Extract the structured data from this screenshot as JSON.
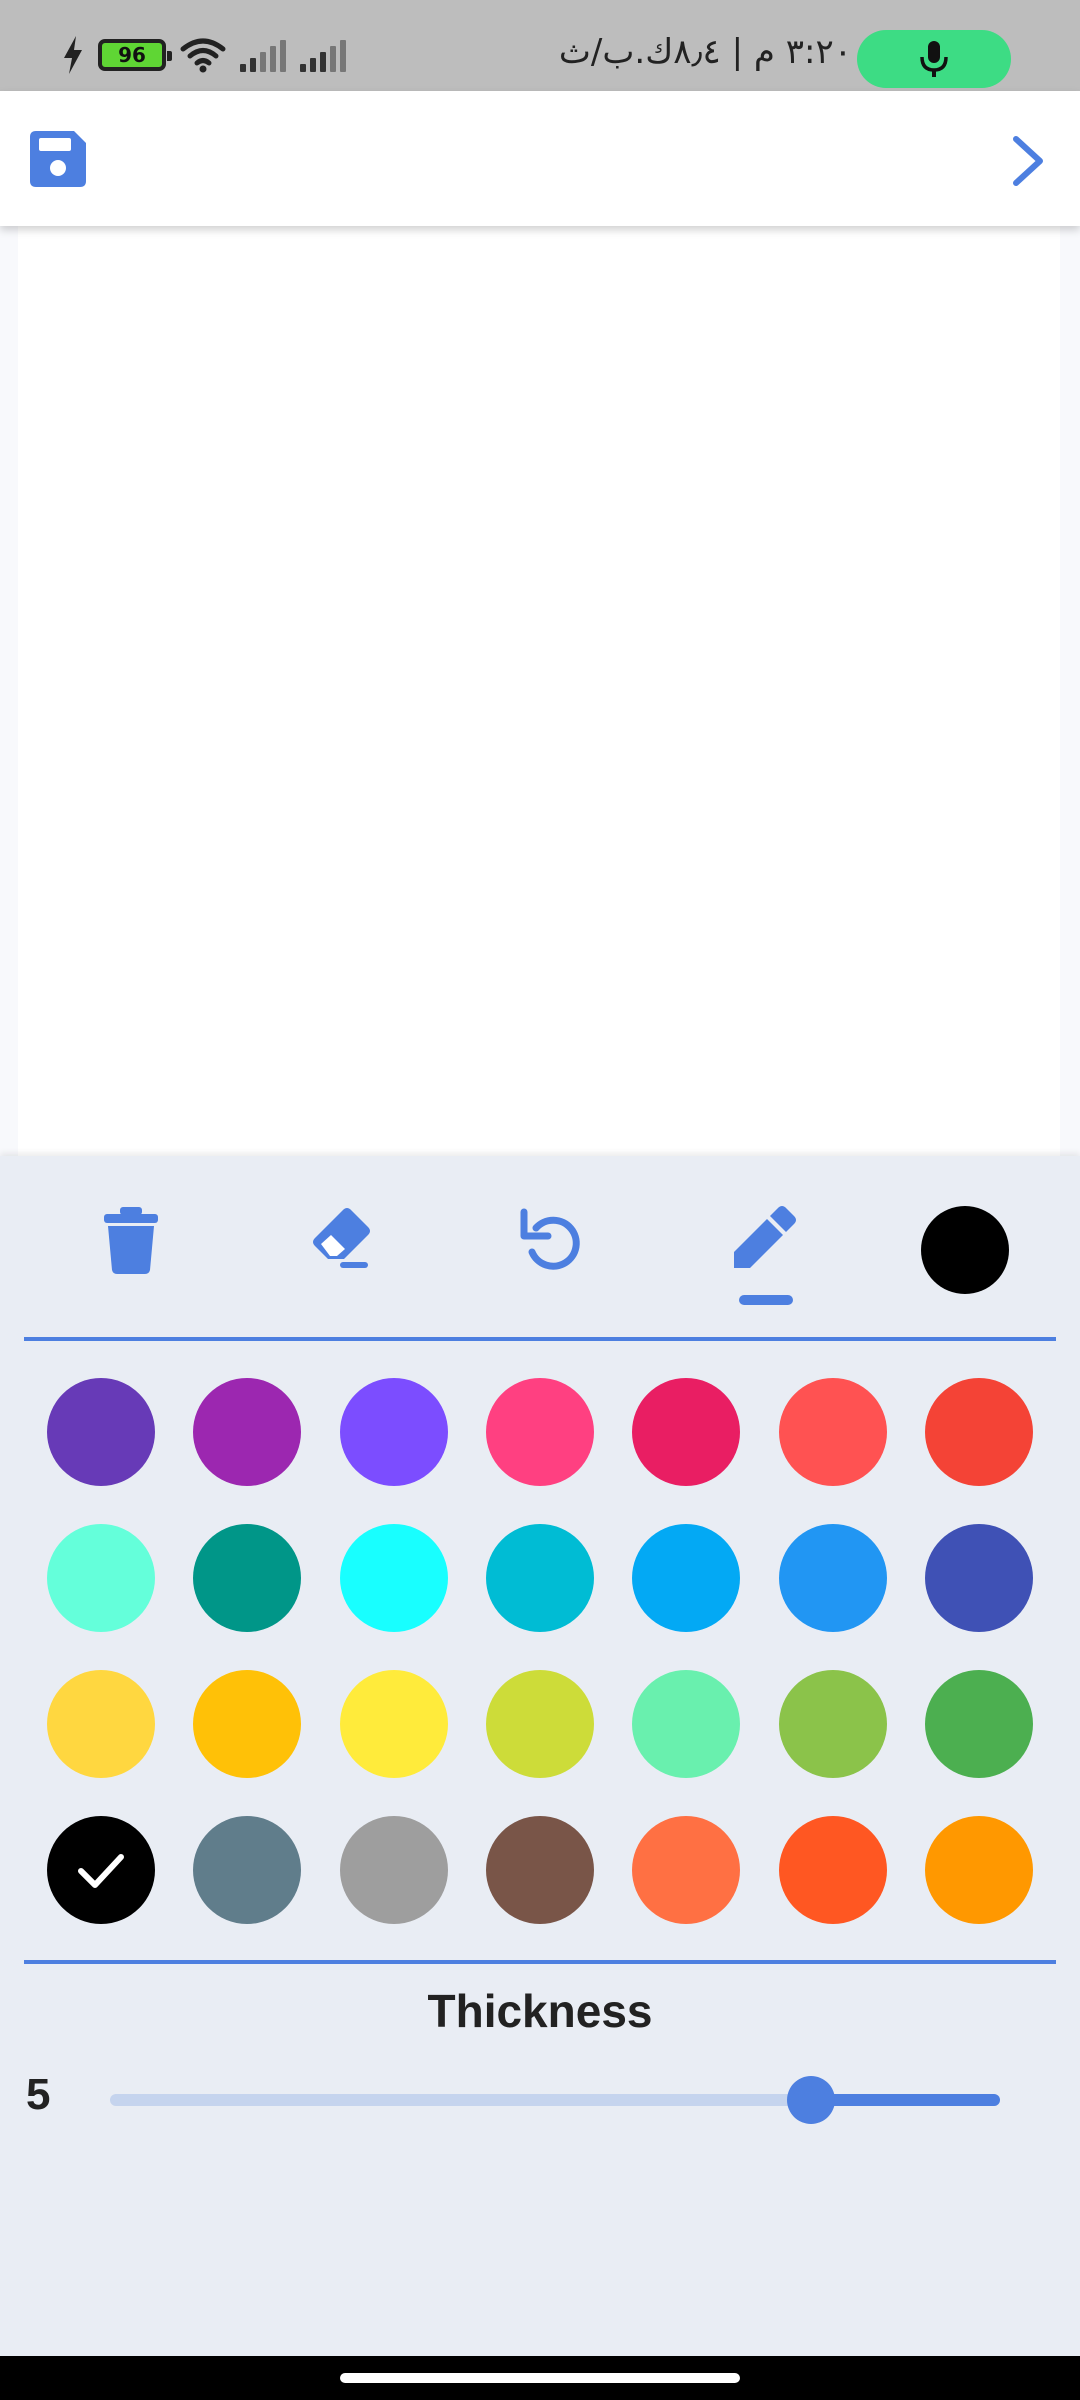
{
  "status_bar": {
    "battery_level": "96",
    "time_and_speed": "٣:٢٠ م | ٨٫٤ك.ب/ث",
    "mic_pill_color": "#3ddc84"
  },
  "app_bar": {
    "save_icon": "floppy-disk-icon",
    "next_icon": "chevron-right-icon",
    "accent": "#4d7fe0"
  },
  "tools": {
    "items": [
      {
        "name": "clear-tool",
        "icon": "trash-icon"
      },
      {
        "name": "eraser-tool",
        "icon": "eraser-icon"
      },
      {
        "name": "undo-tool",
        "icon": "undo-icon"
      },
      {
        "name": "pen-tool",
        "icon": "pencil-icon",
        "selected": true
      }
    ],
    "current_color": "#000000"
  },
  "palette": {
    "selected_color": "#000000",
    "colors": [
      [
        "#673ab7",
        "#9c27b0",
        "#7c4dff",
        "#ff4081",
        "#e91e63",
        "#ff5252",
        "#f44336"
      ],
      [
        "#64ffda",
        "#009688",
        "#18ffff",
        "#00bcd4",
        "#03a9f4",
        "#2196f3",
        "#3f51b5"
      ],
      [
        "#ffd740",
        "#ffc107",
        "#ffeb3b",
        "#cddc39",
        "#69f0ae",
        "#8bc34a",
        "#4caf50"
      ],
      [
        "#000000",
        "#607d8b",
        "#9e9e9e",
        "#795548",
        "#ff7043",
        "#ff5722",
        "#ff9800"
      ]
    ]
  },
  "thickness": {
    "title": "Thickness",
    "value": "5",
    "fraction": 0.788
  }
}
